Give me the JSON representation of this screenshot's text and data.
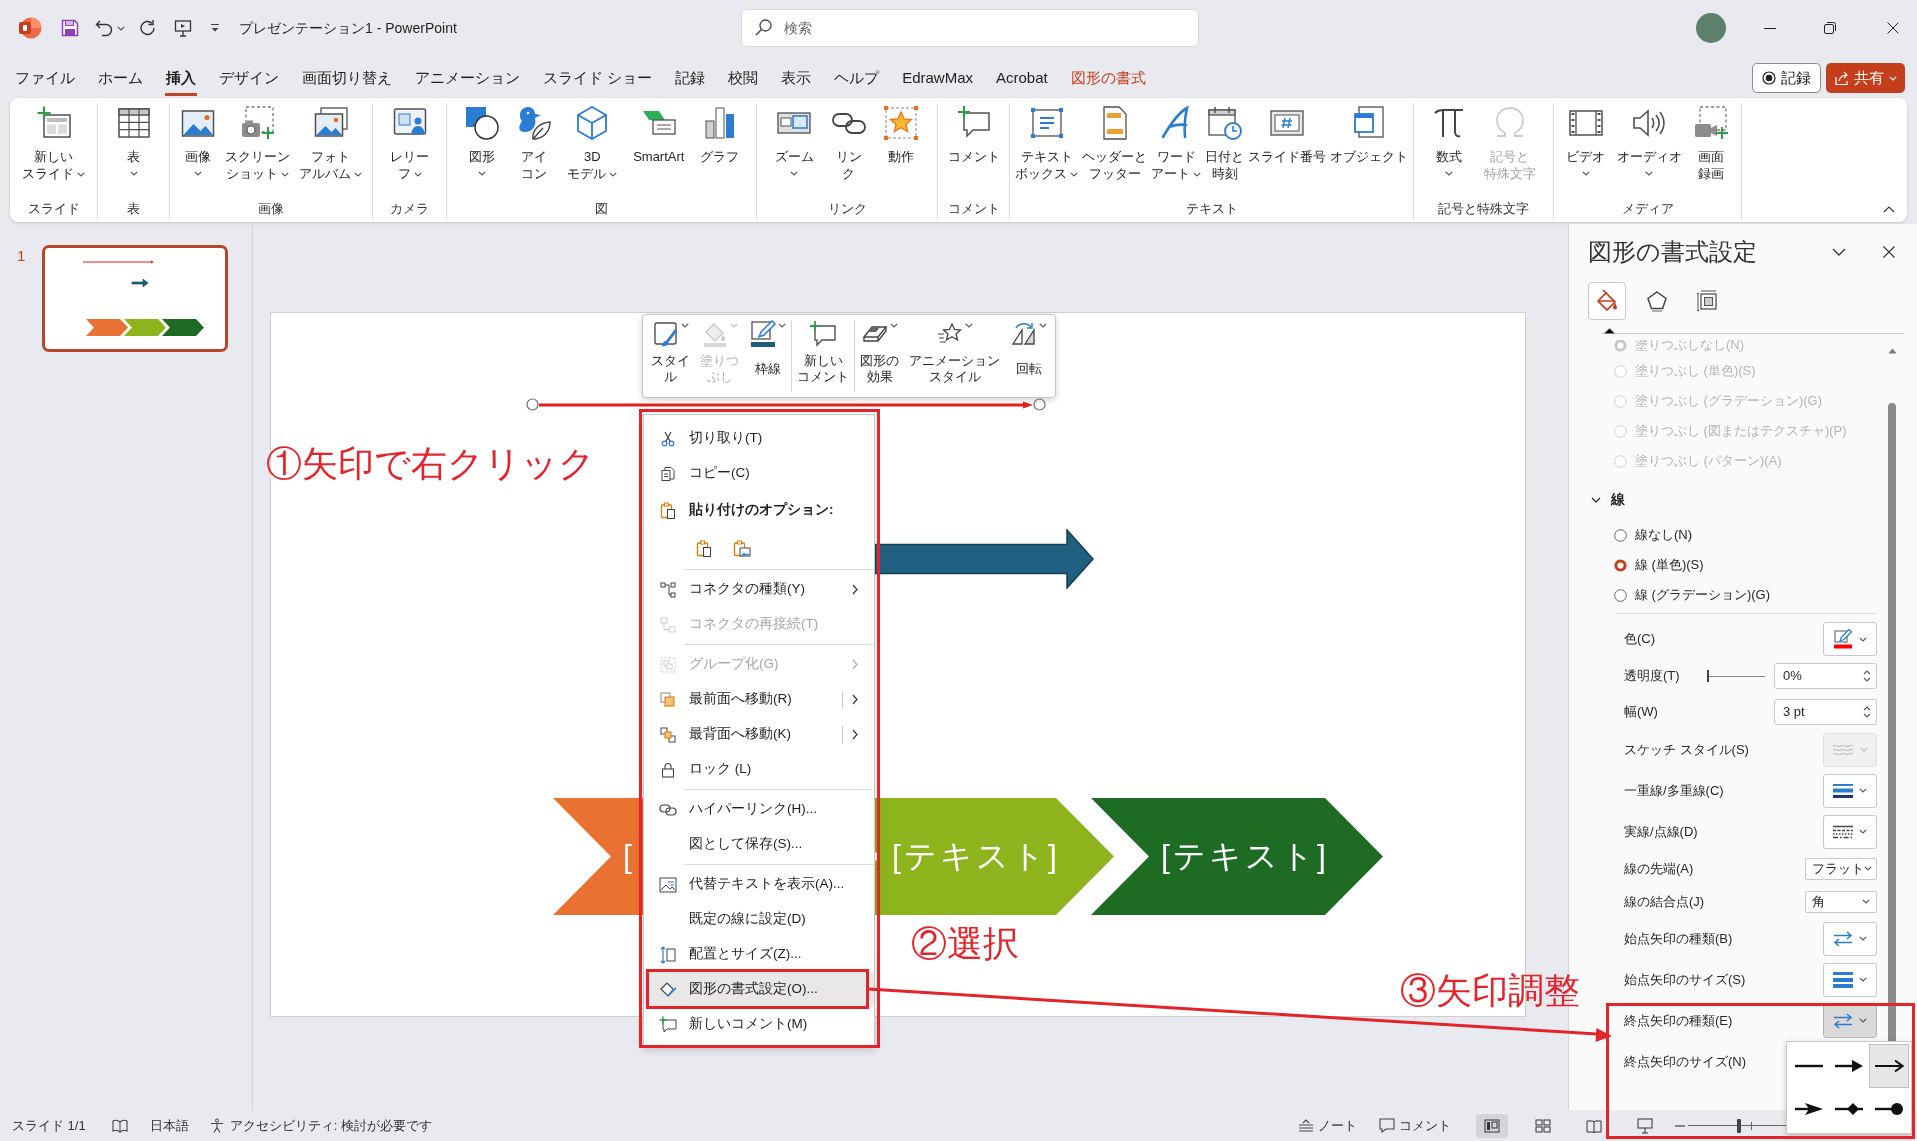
{
  "title_bar": {
    "title": "プレゼンテーション1 - PowerPoint",
    "search": {
      "placeholder": "検索"
    }
  },
  "menu_tabs": [
    {
      "label": "ファイル",
      "selected": false,
      "kind": "standard"
    },
    {
      "label": "ホーム",
      "selected": false,
      "kind": "standard"
    },
    {
      "label": "挿入",
      "selected": true,
      "kind": "standard"
    },
    {
      "label": "デザイン",
      "selected": false,
      "kind": "standard"
    },
    {
      "label": "画面切り替え",
      "selected": false,
      "kind": "standard"
    },
    {
      "label": "アニメーション",
      "selected": false,
      "kind": "standard"
    },
    {
      "label": "スライド ショー",
      "selected": false,
      "kind": "standard"
    },
    {
      "label": "記録",
      "selected": false,
      "kind": "standard"
    },
    {
      "label": "校閲",
      "selected": false,
      "kind": "standard"
    },
    {
      "label": "表示",
      "selected": false,
      "kind": "standard"
    },
    {
      "label": "ヘルプ",
      "selected": false,
      "kind": "standard"
    },
    {
      "label": "EdrawMax",
      "selected": false,
      "kind": "standard"
    },
    {
      "label": "Acrobat",
      "selected": false,
      "kind": "standard"
    },
    {
      "label": "図形の書式",
      "selected": false,
      "kind": "contextual"
    }
  ],
  "header_buttons": [
    {
      "label": "記録",
      "kind": "record"
    },
    {
      "label": "共有",
      "kind": "share"
    }
  ],
  "ribbon": {
    "groups": [
      {
        "label": "スライド",
        "buttons": [
          {
            "lines": [
              "新しい",
              "スライド"
            ],
            "dropdown": true,
            "disabled": false
          }
        ]
      },
      {
        "label": "表",
        "buttons": [
          {
            "lines": [
              "表"
            ],
            "dropdown": true,
            "disabled": false
          }
        ]
      },
      {
        "label": "画像",
        "buttons": [
          {
            "lines": [
              "画像"
            ],
            "dropdown": true,
            "disabled": false
          },
          {
            "lines": [
              "スクリーン",
              "ショット"
            ],
            "dropdown": true,
            "disabled": false
          },
          {
            "lines": [
              "フォト",
              "アルバム"
            ],
            "dropdown": true,
            "disabled": false
          }
        ]
      },
      {
        "label": "カメラ",
        "buttons": [
          {
            "lines": [
              "レリー",
              "フ"
            ],
            "dropdown": true,
            "disabled": false
          }
        ]
      },
      {
        "label": "図",
        "buttons": [
          {
            "lines": [
              "図形"
            ],
            "dropdown": true,
            "disabled": false
          },
          {
            "lines": [
              "アイ",
              "コン"
            ],
            "dropdown": false,
            "disabled": false
          },
          {
            "lines": [
              "3D",
              "モデル"
            ],
            "dropdown": true,
            "disabled": false
          },
          {
            "lines": [
              "SmartArt"
            ],
            "dropdown": false,
            "disabled": false
          },
          {
            "lines": [
              "グラフ"
            ],
            "dropdown": false,
            "disabled": false
          }
        ]
      },
      {
        "label": "リンク",
        "buttons": [
          {
            "lines": [
              "ズーム"
            ],
            "dropdown": true,
            "disabled": false
          },
          {
            "lines": [
              "リン",
              "ク"
            ],
            "dropdown": false,
            "disabled": false
          },
          {
            "lines": [
              "動作"
            ],
            "dropdown": false,
            "disabled": false
          }
        ]
      },
      {
        "label": "コメント",
        "buttons": [
          {
            "lines": [
              "コメント"
            ],
            "dropdown": false,
            "disabled": false
          }
        ]
      },
      {
        "label": "テキスト",
        "buttons": [
          {
            "lines": [
              "テキスト",
              "ボックス"
            ],
            "dropdown": true,
            "disabled": false
          },
          {
            "lines": [
              "ヘッダーと",
              "フッター"
            ],
            "dropdown": false,
            "disabled": false
          },
          {
            "lines": [
              "ワード",
              "アート"
            ],
            "dropdown": true,
            "disabled": false
          },
          {
            "lines": [
              "日付と",
              "時刻"
            ],
            "dropdown": false,
            "disabled": false
          },
          {
            "lines": [
              "スライド番号"
            ],
            "dropdown": false,
            "disabled": false
          },
          {
            "lines": [
              "オブジェクト"
            ],
            "dropdown": false,
            "disabled": false
          }
        ]
      },
      {
        "label": "記号と特殊文字",
        "buttons": [
          {
            "lines": [
              "数式"
            ],
            "dropdown": true,
            "disabled": false
          },
          {
            "lines": [
              "記号と",
              "特殊文字"
            ],
            "dropdown": false,
            "disabled": true
          }
        ]
      },
      {
        "label": "メディア",
        "buttons": [
          {
            "lines": [
              "ビデオ"
            ],
            "dropdown": true,
            "disabled": false
          },
          {
            "lines": [
              "オーディオ"
            ],
            "dropdown": true,
            "disabled": false
          },
          {
            "lines": [
              "画面",
              "録画"
            ],
            "dropdown": false,
            "disabled": false
          }
        ]
      }
    ]
  },
  "thumbnail": {
    "number": "1",
    "selected": true
  },
  "slide": {
    "connector": {
      "selected": true
    },
    "chevrons": [
      {
        "text": "[",
        "color": "#e97132"
      },
      {
        "text": "[テキスト]",
        "color": "#8db31d"
      },
      {
        "text": "[テキスト]",
        "color": "#1e6b24"
      }
    ]
  },
  "mini_toolbar": {
    "groups": [
      {
        "buttons": [
          {
            "lines": [
              "スタイ",
              "ル"
            ],
            "dropdown": true,
            "disabled": false
          },
          {
            "lines": [
              "塗りつ",
              "ぶし"
            ],
            "dropdown": true,
            "disabled": true
          },
          {
            "lines": [
              "枠線"
            ],
            "dropdown": true,
            "disabled": false
          }
        ]
      },
      {
        "buttons": [
          {
            "lines": [
              "新しい",
              "コメント"
            ],
            "dropdown": false,
            "disabled": false
          }
        ]
      },
      {
        "buttons": [
          {
            "lines": [
              "図形の",
              "効果"
            ],
            "dropdown": true,
            "disabled": false
          },
          {
            "lines": [
              "アニメーション",
              "スタイル"
            ],
            "dropdown": true,
            "disabled": false
          },
          {
            "lines": [
              "回転"
            ],
            "dropdown": true,
            "disabled": false
          }
        ]
      }
    ]
  },
  "context_menu": {
    "clipboard": [
      {
        "label": "切り取り(T)",
        "disabled": false,
        "submenu": false,
        "split": false,
        "selected": false
      },
      {
        "label": "コピー(C)",
        "disabled": false,
        "submenu": false,
        "split": false,
        "selected": false
      }
    ],
    "paste_heading": "貼り付けのオプション:",
    "sections": [
      {
        "items": [
          {
            "label": "コネクタの種類(Y)",
            "disabled": false,
            "submenu": true,
            "split": false,
            "selected": false
          },
          {
            "label": "コネクタの再接続(T)",
            "disabled": true,
            "submenu": false,
            "split": false,
            "selected": false
          }
        ]
      },
      {
        "items": [
          {
            "label": "グループ化(G)",
            "disabled": true,
            "submenu": true,
            "split": false,
            "selected": false
          },
          {
            "label": "最前面へ移動(R)",
            "disabled": false,
            "submenu": true,
            "split": true,
            "selected": false
          },
          {
            "label": "最背面へ移動(K)",
            "disabled": false,
            "submenu": true,
            "split": true,
            "selected": false
          },
          {
            "label": "ロック (L)",
            "disabled": false,
            "submenu": false,
            "split": false,
            "selected": false
          }
        ]
      },
      {
        "items": [
          {
            "label": "ハイパーリンク(H)...",
            "disabled": false,
            "submenu": false,
            "split": false,
            "selected": false
          },
          {
            "label": "図として保存(S)...",
            "disabled": false,
            "submenu": false,
            "split": false,
            "selected": false
          }
        ]
      },
      {
        "items": [
          {
            "label": "代替テキストを表示(A)...",
            "disabled": false,
            "submenu": false,
            "split": false,
            "selected": false
          },
          {
            "label": "既定の線に設定(D)",
            "disabled": false,
            "submenu": false,
            "split": false,
            "selected": false
          },
          {
            "label": "配置とサイズ(Z)...",
            "disabled": false,
            "submenu": false,
            "split": false,
            "selected": false
          },
          {
            "label": "図形の書式設定(O)...",
            "disabled": false,
            "submenu": false,
            "split": false,
            "selected": true
          },
          {
            "label": "新しいコメント(M)",
            "disabled": false,
            "submenu": false,
            "split": false,
            "selected": false
          }
        ]
      }
    ]
  },
  "format_pane": {
    "title": "図形の書式設定",
    "tabs": [
      {
        "selected": true
      },
      {
        "selected": false
      },
      {
        "selected": false
      }
    ],
    "fill_options": [
      {
        "label": "塗りつぶしなし(N)",
        "selected": true,
        "disabled": true
      },
      {
        "label": "塗りつぶし (単色)(S)",
        "selected": false,
        "disabled": true
      },
      {
        "label": "塗りつぶし (グラデーション)(G)",
        "selected": false,
        "disabled": true
      },
      {
        "label": "塗りつぶし (図またはテクスチャ)(P)",
        "selected": false,
        "disabled": true
      },
      {
        "label": "塗りつぶし (パターン)(A)",
        "selected": false,
        "disabled": true
      }
    ],
    "line_section": {
      "title": "線",
      "expanded": true,
      "options": [
        {
          "label": "線なし(N)",
          "selected": false
        },
        {
          "label": "線 (単色)(S)",
          "selected": true
        },
        {
          "label": "線 (グラデーション)(G)",
          "selected": false
        }
      ],
      "properties": [
        {
          "label": "色(C)",
          "kind": "color"
        },
        {
          "label": "透明度(T)",
          "kind": "slider",
          "value": "0%",
          "level": 0
        },
        {
          "label": "幅(W)",
          "kind": "spin",
          "value": "3 pt"
        },
        {
          "label": "スケッチ スタイル(S)",
          "kind": "icon",
          "disabled": true,
          "pressed": false
        },
        {
          "label": "一重線/多重線(C)",
          "kind": "icon",
          "disabled": false,
          "pressed": false
        },
        {
          "label": "実線/点線(D)",
          "kind": "icon",
          "disabled": false,
          "pressed": false
        },
        {
          "label": "線の先端(A)",
          "kind": "select",
          "value": "フラット"
        },
        {
          "label": "線の結合点(J)",
          "kind": "select",
          "value": "角"
        },
        {
          "label": "始点矢印の種類(B)",
          "kind": "icon",
          "disabled": false,
          "pressed": false
        },
        {
          "label": "始点矢印のサイズ(S)",
          "kind": "icon",
          "disabled": false,
          "pressed": false
        },
        {
          "label": "終点矢印の種類(E)",
          "kind": "icon",
          "disabled": false,
          "pressed": true
        },
        {
          "label": "終点矢印のサイズ(N)",
          "kind": "plain"
        }
      ]
    }
  },
  "arrow_type_menu": {
    "options": [
      {
        "selected": false
      },
      {
        "selected": false
      },
      {
        "selected": true
      },
      {
        "selected": false
      },
      {
        "selected": false
      },
      {
        "selected": false
      }
    ]
  },
  "status_bar": {
    "slide_counter": "スライド 1/1",
    "language": "日本語",
    "accessibility": "アクセシビリティ: 検討が必要です",
    "notes": "ノート",
    "comments": "コメント",
    "views": [
      {
        "selected": true
      },
      {
        "selected": false
      },
      {
        "selected": false
      },
      {
        "selected": false
      }
    ],
    "zoom_slider": {
      "level": 0.4
    }
  },
  "annotations": [
    {
      "text": "①矢印で右クリック"
    },
    {
      "text": "②選択"
    },
    {
      "text": "③矢印調整"
    }
  ]
}
